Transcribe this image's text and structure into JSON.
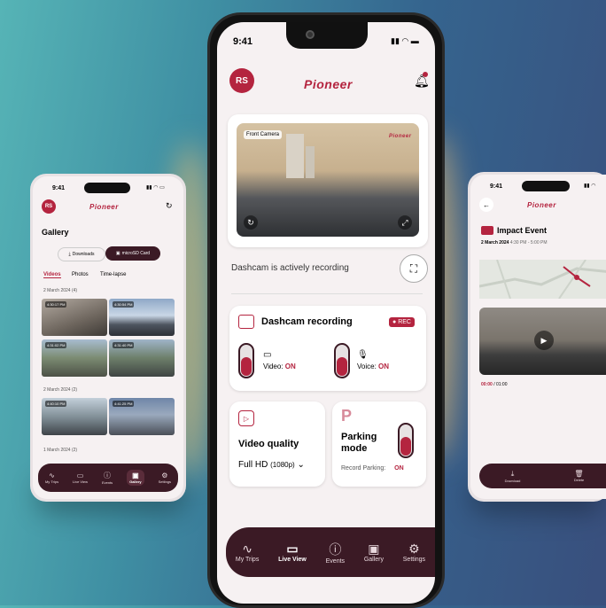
{
  "brand": "Pioneer",
  "colors": {
    "accent": "#b4243f",
    "nav": "#3b1a25"
  },
  "center": {
    "time": "9:41",
    "avatar": "RS",
    "camera_label": "Front Camera",
    "status": "Dashcam is actively recording",
    "recording": {
      "title": "Dashcam recording",
      "rec_badge": "REC",
      "video_label": "Video:",
      "video_state": "ON",
      "voice_label": "Voice:",
      "voice_state": "ON"
    },
    "quality": {
      "title": "Video quality",
      "value": "Full HD",
      "detail": "(1080p)"
    },
    "parking": {
      "letter": "P",
      "title_line1": "Parking",
      "title_line2": "mode",
      "record_label": "Record Parking:",
      "record_state": "ON"
    },
    "nav": [
      {
        "label": "My Trips",
        "icon": "route-icon"
      },
      {
        "label": "Live View",
        "icon": "video-icon"
      },
      {
        "label": "Events",
        "icon": "alert-icon"
      },
      {
        "label": "Gallery",
        "icon": "gallery-icon"
      },
      {
        "label": "Settings",
        "icon": "gear-icon"
      }
    ]
  },
  "left": {
    "time": "9:41",
    "avatar": "RS",
    "title": "Gallery",
    "source_downloads": "Downloads",
    "source_sd": "microSD Card",
    "tabs": [
      "Videos",
      "Photos",
      "Time-lapse"
    ],
    "sections": [
      {
        "date": "2 March 2024",
        "count": "(4)",
        "stamps": [
          "4:30:17 PM",
          "4:30:54 PM",
          "4:31:02 PM",
          "4:31:40 PM"
        ]
      },
      {
        "date": "2 March 2024",
        "count": "(2)",
        "stamps": [
          "4:40:10 PM",
          "4:41:25 PM"
        ]
      },
      {
        "date": "1 March 2024",
        "count": "(2)"
      }
    ],
    "nav": [
      "My Trips",
      "Live View",
      "Events",
      "Gallery",
      "Settings"
    ]
  },
  "right": {
    "time": "9:41",
    "event_title": "Impact Event",
    "event_date": "2 March 2024",
    "event_range": "4:30 PM - 5:00 PM",
    "elapsed": "00:00",
    "duration": "/ 01:00",
    "actions": [
      "Download",
      "Delete"
    ]
  }
}
